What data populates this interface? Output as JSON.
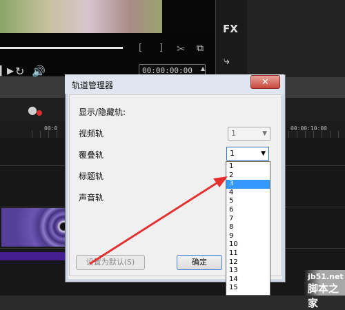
{
  "editor": {
    "fx_label": "FX",
    "timecode": "00:00:00:00",
    "ruler_start": "00:0",
    "ruler_end": "00:00:10:00"
  },
  "dialog": {
    "title": "轨道管理器",
    "section_label": "显示/隐藏轨:",
    "rows": [
      {
        "label": "视频轨",
        "value": "1"
      },
      {
        "label": "覆叠轨",
        "value": "1"
      },
      {
        "label": "标题轨"
      },
      {
        "label": "声音轨"
      }
    ],
    "reset_button": "设置为默认(S)",
    "ok_button": "确定",
    "close_symbol": "✕"
  },
  "dropdown": {
    "options": [
      "1",
      "2",
      "3",
      "4",
      "5",
      "6",
      "7",
      "8",
      "9",
      "10",
      "11",
      "12",
      "13",
      "14",
      "15"
    ],
    "selected_index": 2
  },
  "watermark": {
    "url": "jb51.net",
    "text": "脚本之家"
  }
}
